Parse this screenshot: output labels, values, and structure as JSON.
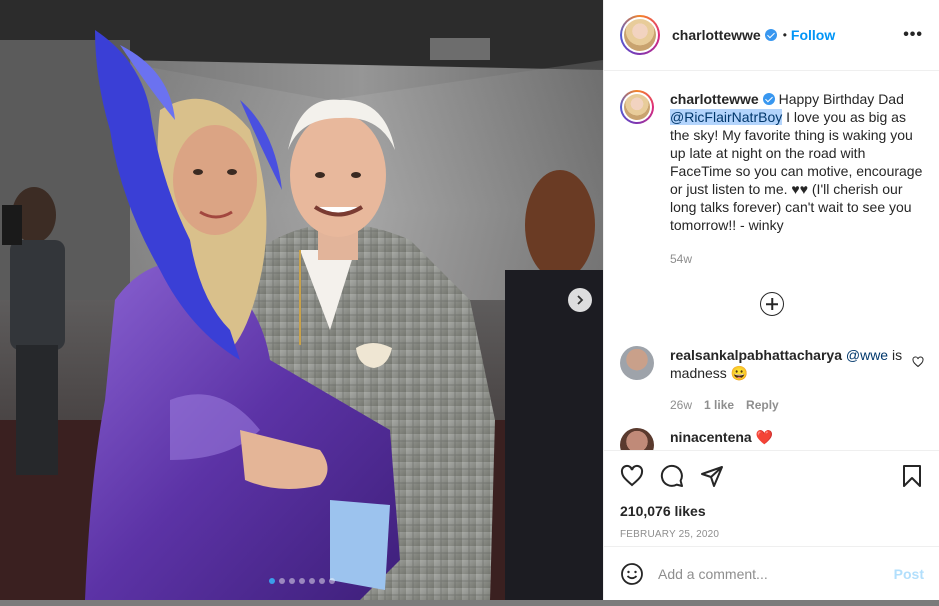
{
  "post": {
    "username": "charlottewwe",
    "follow_label": "Follow",
    "bullet": "•",
    "more_label": "•••",
    "caption": {
      "username": "charlottewwe",
      "text_before": "Happy Birthday Dad ",
      "mention": "@RicFlairNatrBoy",
      "text_after": " I love you as big as the sky! My favorite thing is waking you up late at night on the road with FaceTime so you can motive, encourage or just listen to me. ♥♥ (I'll cherish our long talks forever) can't wait to see you tomorrow!! - winky",
      "time": "54w"
    },
    "comments": [
      {
        "username": "realsankalpabhattacharya",
        "mention": "@wwe",
        "text": "is madness 😀",
        "time": "26w",
        "likes": "1 like",
        "reply": "Reply"
      },
      {
        "username": "ninacentena",
        "text": "❤️"
      }
    ],
    "likes": "210,076 likes",
    "date": "February 25, 2020",
    "add_comment_placeholder": "Add a comment...",
    "post_label": "Post",
    "carousel": {
      "count": 7,
      "active_index": 0
    }
  },
  "icons": {
    "more": "more-options-icon",
    "verified": "verified-badge-icon",
    "load_more": "load-more-comments-icon",
    "heart": "heart-icon",
    "comment": "comment-icon",
    "share": "share-icon",
    "bookmark": "bookmark-icon",
    "emoji": "emoji-icon",
    "next": "chevron-right-icon"
  },
  "colors": {
    "accent": "#0095f6",
    "mention_highlight": "#b3d4fc",
    "dress": "#6b3fb0",
    "feathers": "#3a3fd6"
  }
}
